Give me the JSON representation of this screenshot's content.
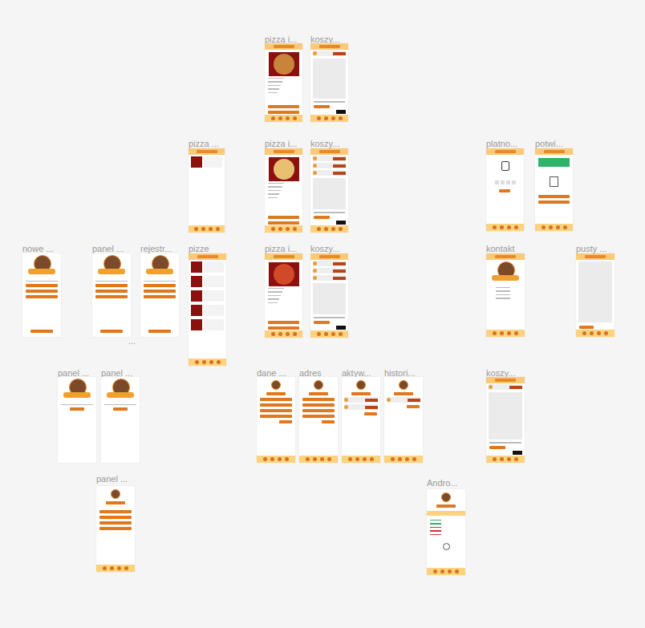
{
  "frames": [
    {
      "label": "pizza i...",
      "kind": "pizza-detail",
      "color": "#c9843c"
    },
    {
      "label": "koszy...",
      "kind": "cart"
    },
    {
      "label": "pizza ...",
      "kind": "menu-short"
    },
    {
      "label": "pizza i...",
      "kind": "pizza-detail",
      "color": "#e8c070"
    },
    {
      "label": "koszy...",
      "kind": "cart"
    },
    {
      "label": "platno...",
      "kind": "payment"
    },
    {
      "label": "potwi...",
      "kind": "confirm"
    },
    {
      "label": "nowe ...",
      "kind": "login"
    },
    {
      "label": "panel ...",
      "kind": "login"
    },
    {
      "label": "rejestr...",
      "kind": "login"
    },
    {
      "label": "pizze",
      "kind": "menu-long"
    },
    {
      "label": "pizza i...",
      "kind": "pizza-detail",
      "color": "#d04a2a"
    },
    {
      "label": "koszy...",
      "kind": "cart"
    },
    {
      "label": "kontakt",
      "kind": "contact"
    },
    {
      "label": "pusty ...",
      "kind": "empty-cart"
    },
    {
      "label": "panel ...",
      "kind": "welcome"
    },
    {
      "label": "panel ...",
      "kind": "welcome"
    },
    {
      "label": "dane ...",
      "kind": "form"
    },
    {
      "label": "adres",
      "kind": "form"
    },
    {
      "label": "aktyw...",
      "kind": "orders"
    },
    {
      "label": "histori...",
      "kind": "orders"
    },
    {
      "label": "koszy...",
      "kind": "cart"
    },
    {
      "label": "panel ...",
      "kind": "admin"
    },
    {
      "label": "Andro...",
      "kind": "status"
    }
  ],
  "note": "..."
}
